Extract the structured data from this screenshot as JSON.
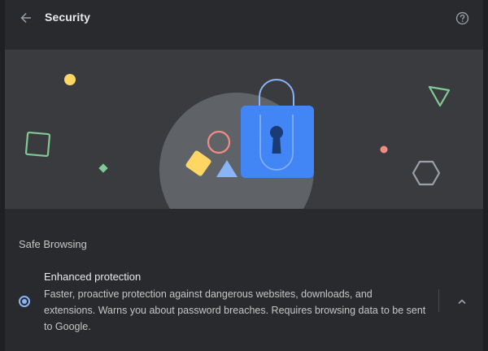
{
  "header": {
    "title": "Security",
    "back_icon": "arrow-back-icon",
    "help_icon": "help-icon"
  },
  "banner": {
    "illustration": "padlock-with-shapes",
    "colors": {
      "background": "#3a3b3e",
      "lock_body": "#4285f4",
      "shackle": "#8ab4f8",
      "circle_large": "#5f6368",
      "yellow": "#fdd663",
      "green": "#81c995",
      "coral": "#f28b82",
      "light_blue": "#8ab4f8",
      "gray_shape": "#9aa0a6"
    }
  },
  "safe_browsing": {
    "section_title": "Safe Browsing",
    "option": {
      "title": "Enhanced protection",
      "description": "Faster, proactive protection against dangerous websites, downloads, and extensions. Warns you about password breaches. Requires browsing data to be sent to Google.",
      "selected": true,
      "expand_icon": "chevron-up-icon"
    }
  }
}
